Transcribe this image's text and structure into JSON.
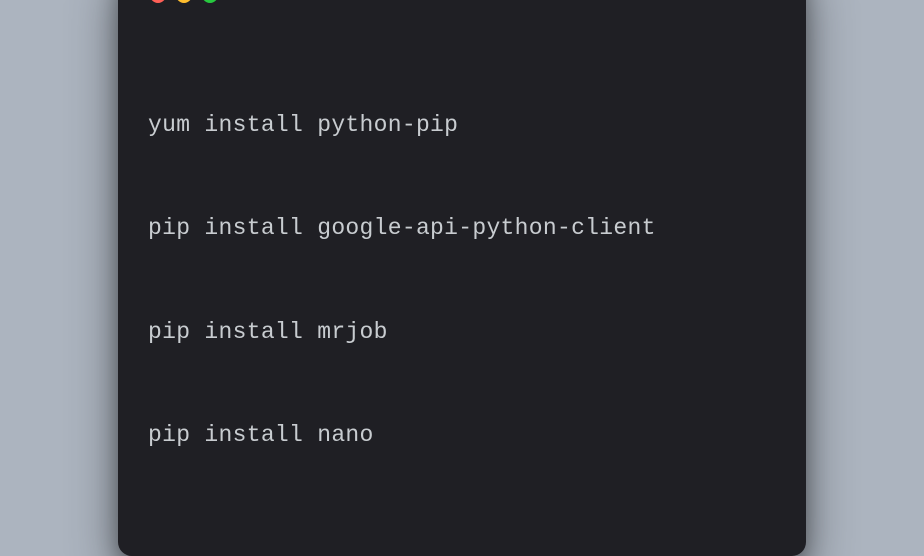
{
  "terminal": {
    "buttons": {
      "close": "red",
      "minimize": "yellow",
      "maximize": "green"
    },
    "lines": [
      "yum install python-pip",
      "pip install google-api-python-client",
      "pip install mrjob",
      "pip install nano"
    ]
  }
}
